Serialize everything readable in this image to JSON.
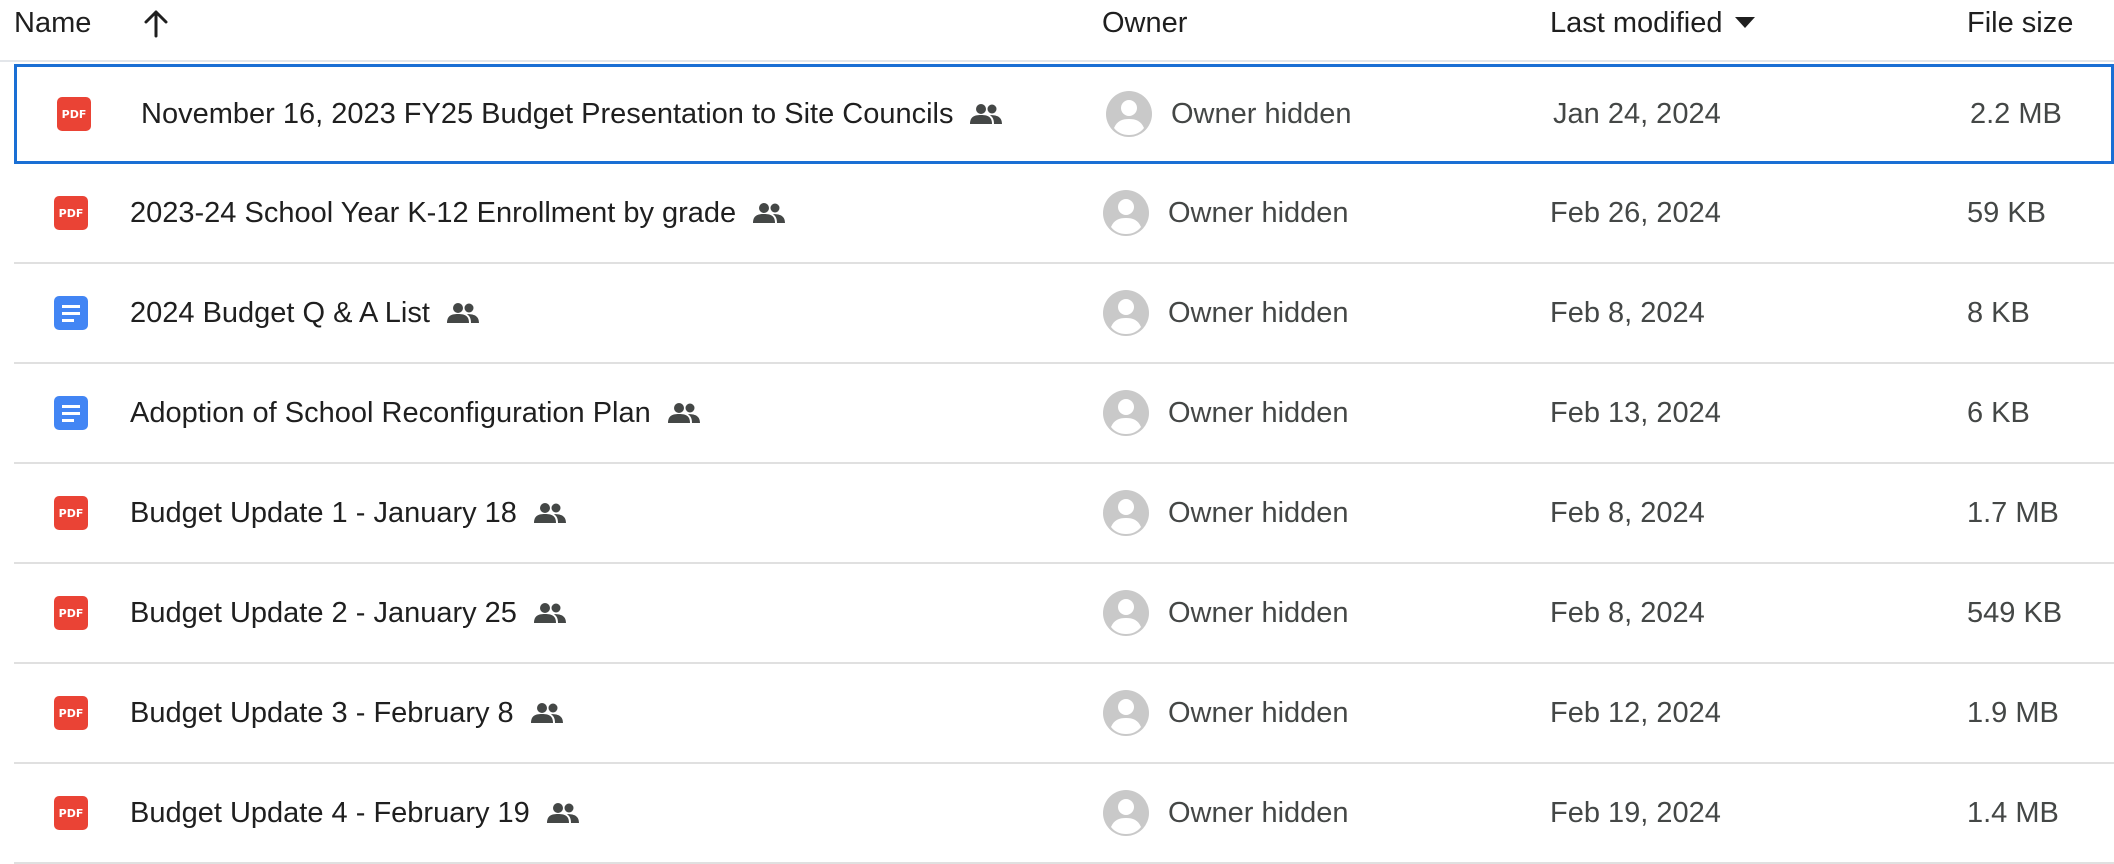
{
  "header": {
    "name_label": "Name",
    "sort_direction_icon": "arrow-up-icon",
    "owner_label": "Owner",
    "modified_label": "Last modified",
    "modified_sort_icon": "caret-down-icon",
    "size_label": "File size"
  },
  "colors": {
    "pdf": "#ea4335",
    "doc": "#4285f4",
    "selection_border": "#1a6fd4"
  },
  "files": [
    {
      "type": "pdf",
      "icon": "pdf-icon",
      "name": "November 16, 2023 FY25 Budget Presentation to Site Councils",
      "shared_icon": "shared-people-icon",
      "owner": "Owner hidden",
      "modified": "Jan 24, 2024",
      "size": "2.2 MB",
      "selected": true
    },
    {
      "type": "pdf",
      "icon": "pdf-icon",
      "name": "2023-24 School Year K-12 Enrollment by grade",
      "shared_icon": "shared-people-icon",
      "owner": "Owner hidden",
      "modified": "Feb 26, 2024",
      "size": "59 KB",
      "selected": false
    },
    {
      "type": "doc",
      "icon": "google-docs-icon",
      "name": "2024 Budget Q & A List",
      "shared_icon": "shared-people-icon",
      "owner": "Owner hidden",
      "modified": "Feb 8, 2024",
      "size": "8 KB",
      "selected": false
    },
    {
      "type": "doc",
      "icon": "google-docs-icon",
      "name": "Adoption of School Reconfiguration Plan",
      "shared_icon": "shared-people-icon",
      "owner": "Owner hidden",
      "modified": "Feb 13, 2024",
      "size": "6 KB",
      "selected": false
    },
    {
      "type": "pdf",
      "icon": "pdf-icon",
      "name": "Budget Update 1 - January 18",
      "shared_icon": "shared-people-icon",
      "owner": "Owner hidden",
      "modified": "Feb 8, 2024",
      "size": "1.7 MB",
      "selected": false
    },
    {
      "type": "pdf",
      "icon": "pdf-icon",
      "name": "Budget Update 2 - January 25",
      "shared_icon": "shared-people-icon",
      "owner": "Owner hidden",
      "modified": "Feb 8, 2024",
      "size": "549 KB",
      "selected": false
    },
    {
      "type": "pdf",
      "icon": "pdf-icon",
      "name": "Budget Update 3 - February 8",
      "shared_icon": "shared-people-icon",
      "owner": "Owner hidden",
      "modified": "Feb 12, 2024",
      "size": "1.9 MB",
      "selected": false
    },
    {
      "type": "pdf",
      "icon": "pdf-icon",
      "name": "Budget Update 4 - February 19",
      "shared_icon": "shared-people-icon",
      "owner": "Owner hidden",
      "modified": "Feb 19, 2024",
      "size": "1.4 MB",
      "selected": false
    }
  ]
}
